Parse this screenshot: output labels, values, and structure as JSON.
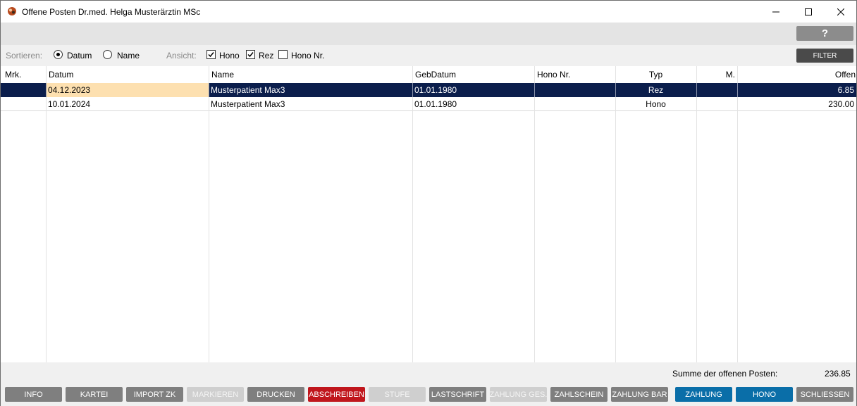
{
  "window": {
    "title": "Offene Posten Dr.med. Helga Musterärztin MSc"
  },
  "help": {
    "label": "?"
  },
  "options": {
    "sort_label": "Sortieren:",
    "sort_datum": "Datum",
    "sort_name": "Name",
    "sort_selected": "Datum",
    "view_label": "Ansicht:",
    "view_hono": "Hono",
    "view_rez": "Rez",
    "view_hono_nr": "Hono Nr.",
    "view_hono_checked": true,
    "view_rez_checked": true,
    "view_hono_nr_checked": false,
    "filter_label": "FILTER"
  },
  "table": {
    "headers": [
      "Mrk.",
      "Datum",
      "Name",
      "GebDatum",
      "Hono Nr.",
      "Typ",
      "M.",
      "Offen"
    ],
    "rows": [
      {
        "mrk": "",
        "datum": "04.12.2023",
        "name": "Musterpatient Max3",
        "gebdatum": "01.01.1980",
        "hono_nr": "",
        "typ": "Rez",
        "m": "",
        "offen": "6.85",
        "selected": true
      },
      {
        "mrk": "",
        "datum": "10.01.2024",
        "name": "Musterpatient Max3",
        "gebdatum": "01.01.1980",
        "hono_nr": "",
        "typ": "Hono",
        "m": "",
        "offen": "230.00",
        "selected": false
      }
    ]
  },
  "summary": {
    "label": "Summe der offenen Posten:",
    "value": "236.85"
  },
  "buttons": [
    {
      "label": "INFO",
      "color": "#7f7f7f",
      "enabled": true
    },
    {
      "label": "KARTEI",
      "color": "#7f7f7f",
      "enabled": true
    },
    {
      "label": "IMPORT ZK",
      "color": "#7f7f7f",
      "enabled": true
    },
    {
      "label": "MARKIEREN",
      "color": "#cfcfcf",
      "enabled": false
    },
    {
      "label": "DRUCKEN",
      "color": "#7f7f7f",
      "enabled": true
    },
    {
      "label": "ABSCHREIBEN",
      "color": "#c0161c",
      "enabled": true
    },
    {
      "label": "STUFE",
      "color": "#cfcfcf",
      "enabled": false
    },
    {
      "label": "LASTSCHRIFT",
      "color": "#7f7f7f",
      "enabled": true
    },
    {
      "label": "ZAHLUNG GES.",
      "color": "#cfcfcf",
      "enabled": false
    },
    {
      "label": "ZAHLSCHEIN",
      "color": "#7f7f7f",
      "enabled": true
    },
    {
      "label": "ZAHLUNG BAR",
      "color": "#7f7f7f",
      "enabled": true
    },
    {
      "label": "ZAHLUNG",
      "color": "#0a6ea8",
      "enabled": true
    },
    {
      "label": "HONO",
      "color": "#0a6ea8",
      "enabled": true
    },
    {
      "label": "SCHLIESSEN",
      "color": "#7f7f7f",
      "enabled": true
    }
  ]
}
